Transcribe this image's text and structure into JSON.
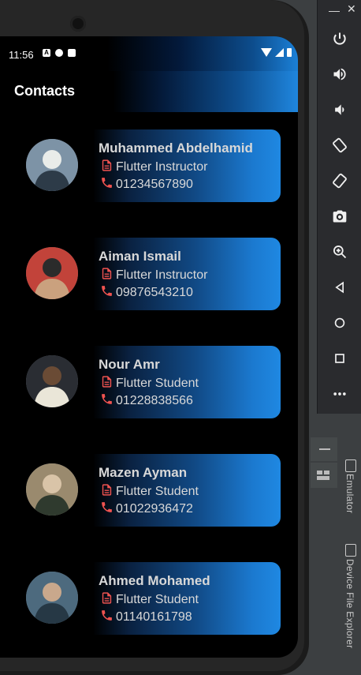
{
  "status_bar": {
    "time": "11:56"
  },
  "app_bar": {
    "title": "Contacts"
  },
  "contacts": [
    {
      "name": "Muhammed Abdelhamid",
      "role": "Flutter Instructor",
      "phone": "01234567890"
    },
    {
      "name": "Aiman Ismail",
      "role": "Flutter Instructor",
      "phone": "09876543210"
    },
    {
      "name": "Nour Amr",
      "role": "Flutter Student",
      "phone": "01228838566"
    },
    {
      "name": "Mazen Ayman",
      "role": "Flutter Student",
      "phone": "01022936472"
    },
    {
      "name": "Ahmed Mohamed",
      "role": "Flutter Student",
      "phone": "01140161798"
    }
  ],
  "icons": {
    "role": "document-icon",
    "phone": "phone-icon"
  },
  "colors": {
    "accent": "#1f88e2",
    "icon_red": "#ef5350",
    "text": "#d8d8d8"
  },
  "emulator": {
    "minimize_label": "—",
    "close_label": "✕",
    "buttons": [
      "power-icon",
      "volume-up-icon",
      "volume-down-icon",
      "rotate-left-icon",
      "rotate-right-icon",
      "camera-icon",
      "zoom-icon",
      "back-icon",
      "home-icon",
      "overview-icon",
      "more-icon"
    ]
  },
  "ide": {
    "tabs": [
      "Emulator",
      "Device File Explorer"
    ]
  }
}
